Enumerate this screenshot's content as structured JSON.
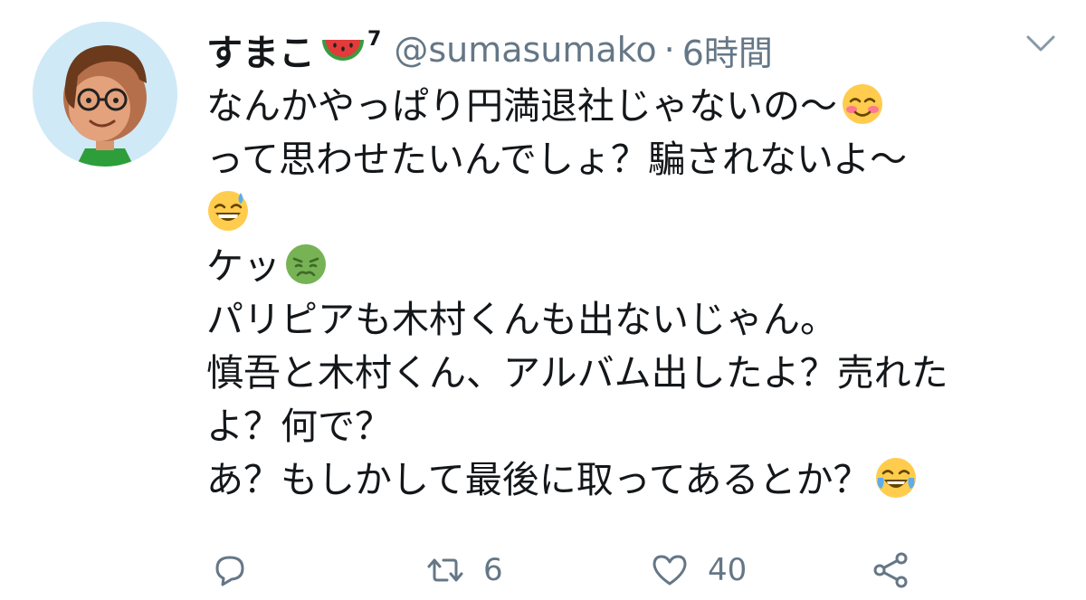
{
  "tweet": {
    "display_name": "すまこ",
    "name_emoji": "watermelon-emoji",
    "name_superscript": "7",
    "handle": "@sumasumako",
    "separator": "·",
    "time": "6時間",
    "lines": [
      "なんかやっぱり円満退社じゃないの〜",
      "って思わせたいんでしょ？騙されないよ〜",
      "",
      "ケッ",
      "パリピアも木村くんも出ないじゃん。",
      "慎吾と木村くん、アルバム出したよ？売れた",
      "よ？何で？",
      "あ？もしかして最後に取ってあるとか？"
    ],
    "line_emojis": [
      "smiling-blush-emoji",
      "",
      "sweat-smile-emoji",
      "nauseated-face-emoji",
      "",
      "",
      "",
      "tears-of-joy-emoji"
    ]
  },
  "actions": {
    "reply_icon": "reply-icon",
    "retweet_icon": "retweet-icon",
    "retweet_count": "6",
    "like_icon": "heart-icon",
    "like_count": "40",
    "share_icon": "share-icon"
  },
  "colors": {
    "text": "#14171a",
    "secondary": "#657786",
    "avatar_bg": "#cfe9f7"
  }
}
